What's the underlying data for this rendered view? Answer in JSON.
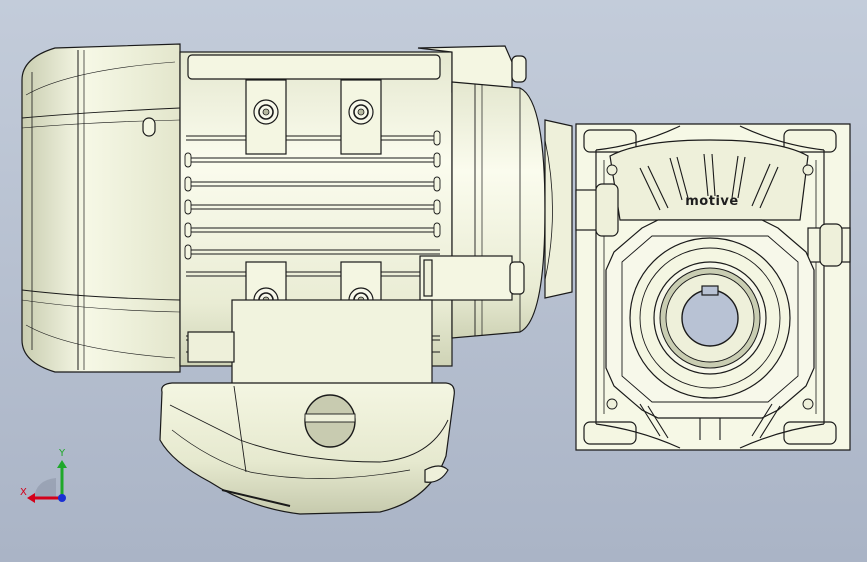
{
  "model": {
    "brand_label": "motive"
  },
  "triad": {
    "x_label": "X",
    "y_label": "Y",
    "x_color": "#d4001a",
    "y_color": "#1fa82a",
    "z_color": "#1a2fd4"
  },
  "colors": {
    "background_top": "#c3ccda",
    "background_bottom": "#aab4c6",
    "body_fill": "#f4f6e2",
    "edge": "#1a1a1a"
  }
}
